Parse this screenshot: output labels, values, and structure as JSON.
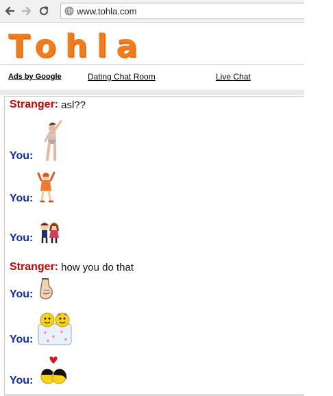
{
  "browser": {
    "url": "www.tohla.com",
    "icons": [
      "back-icon",
      "forward-icon",
      "reload-icon",
      "globe-icon"
    ]
  },
  "site": {
    "logo": "Tohla",
    "logo_color": "#f07c1e"
  },
  "links": {
    "ads": "Ads by Google",
    "dating": "Dating Chat Room",
    "live": "Live Chat"
  },
  "colors": {
    "stranger": "#cc0000",
    "you": "#0f2a9e"
  },
  "chat": {
    "messages": [
      {
        "speaker": "Stranger:",
        "text": "asl??"
      },
      {
        "speaker": "You:",
        "emote": "dancing-woman-emote"
      },
      {
        "speaker": "You:",
        "emote": "waving-dancer-emote"
      },
      {
        "speaker": "You:",
        "emote": "couple-emote"
      },
      {
        "speaker": "Stranger:",
        "text": "how you do that"
      },
      {
        "speaker": "You:",
        "emote": "thumbs-down-emote"
      },
      {
        "speaker": "You:",
        "emote": "smileys-in-box-emote"
      },
      {
        "speaker": "You:",
        "emote": "kissing-couple-emote"
      }
    ]
  }
}
